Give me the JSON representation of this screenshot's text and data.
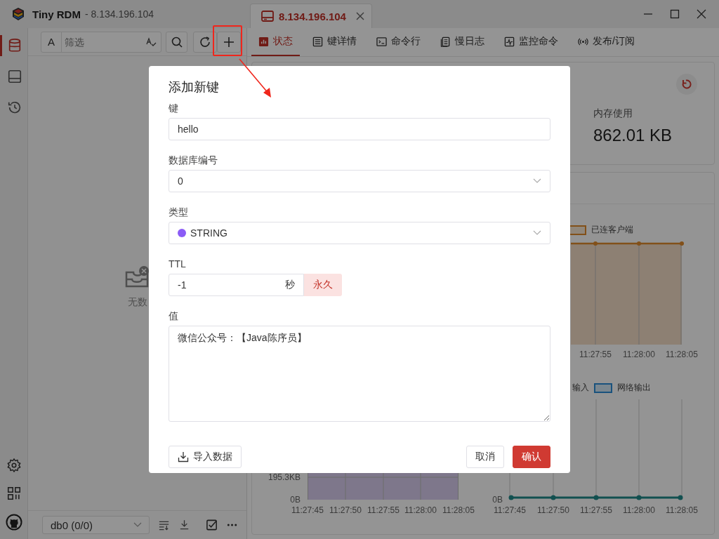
{
  "window": {
    "app_name": "Tiny RDM",
    "subtitle": "- 8.134.196.104"
  },
  "connection_tab": {
    "label": "8.134.196.104",
    "selected": true
  },
  "sidebar": {
    "items": [
      {
        "kind": "database",
        "selected": true
      },
      {
        "kind": "monitor",
        "selected": false
      },
      {
        "kind": "history",
        "selected": false
      }
    ],
    "bottom_items": [
      {
        "kind": "settings"
      },
      {
        "kind": "apps"
      },
      {
        "kind": "github"
      }
    ]
  },
  "browser": {
    "case_toggle": "A",
    "filter_placeholder": "筛选",
    "empty_text": "无数",
    "db_select": "db0 (0/0)"
  },
  "tabs": [
    {
      "label": "状态",
      "kind": "chart",
      "selected": true
    },
    {
      "label": "键详情",
      "kind": "detail",
      "selected": false
    },
    {
      "label": "命令行",
      "kind": "terminal",
      "selected": false
    },
    {
      "label": "慢日志",
      "kind": "log",
      "selected": false
    },
    {
      "label": "监控命令",
      "kind": "pulse",
      "selected": false
    },
    {
      "label": "发布/订阅",
      "kind": "broadcast",
      "selected": false
    }
  ],
  "status": {
    "memory_label": "内存使用",
    "memory_value": "862.01 KB"
  },
  "charts": [
    {
      "legend": [
        {
          "label": "已连客户端",
          "swatch": true
        }
      ],
      "x_ticks": [
        "11:27:55",
        "11:28:00",
        "11:28:05"
      ]
    },
    {
      "y_ticks": [
        "195.3KB",
        "0B"
      ],
      "x_ticks": [
        "11:27:45",
        "11:27:50",
        "11:27:55",
        "11:28:00",
        "11:28:05"
      ]
    },
    {
      "legend": [
        {
          "label": "输入",
          "swatch": false
        },
        {
          "label": "网络输出",
          "swatch": true
        }
      ],
      "y_ticks": [
        "0B"
      ],
      "x_ticks": [
        "11:27:45",
        "11:27:50",
        "11:27:55",
        "11:28:00",
        "11:28:05"
      ]
    }
  ],
  "dialog": {
    "title": "添加新键",
    "fields": [
      {
        "kind": "input",
        "label": "键",
        "value": "hello"
      },
      {
        "kind": "select",
        "label": "数据库编号",
        "value": "0"
      },
      {
        "kind": "type_select",
        "label": "类型",
        "value": "STRING",
        "color": "#8b5cf6"
      },
      {
        "kind": "ttl",
        "label": "TTL",
        "value": "-1",
        "unit": "秒",
        "button": "永久"
      },
      {
        "kind": "textarea",
        "label": "值",
        "value": "微信公众号：【Java陈序员】"
      }
    ],
    "import_button": "导入数据",
    "cancel_button": "取消",
    "confirm_button": "确认"
  }
}
